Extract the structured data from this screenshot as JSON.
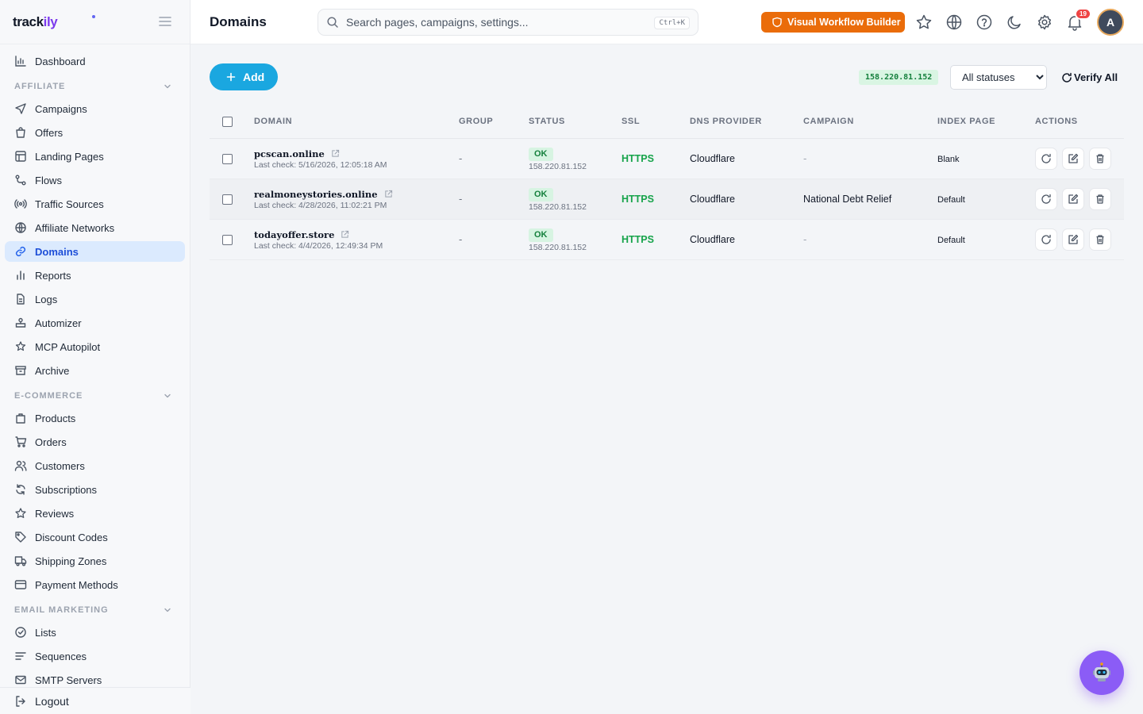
{
  "brand": {
    "prefix": "track",
    "suffix": "ily"
  },
  "sidebar": {
    "items_top": [
      {
        "label": "Dashboard",
        "icon": "dashboard-icon"
      }
    ],
    "sections": [
      {
        "title": "AFFILIATE",
        "items": [
          {
            "label": "Campaigns",
            "icon": "send-icon"
          },
          {
            "label": "Offers",
            "icon": "shopping-bag-icon"
          },
          {
            "label": "Landing Pages",
            "icon": "layout-icon"
          },
          {
            "label": "Flows",
            "icon": "route-icon"
          },
          {
            "label": "Traffic Sources",
            "icon": "radio-icon"
          },
          {
            "label": "Affiliate Networks",
            "icon": "globe-icon"
          },
          {
            "label": "Domains",
            "icon": "link-icon",
            "active": true
          },
          {
            "label": "Reports",
            "icon": "bar-chart-icon"
          },
          {
            "label": "Logs",
            "icon": "file-text-icon"
          },
          {
            "label": "Automizer",
            "icon": "automizer-icon"
          },
          {
            "label": "MCP Autopilot",
            "icon": "sparkle-star-icon"
          },
          {
            "label": "Archive",
            "icon": "archive-icon"
          }
        ]
      },
      {
        "title": "E-COMMERCE",
        "items": [
          {
            "label": "Products",
            "icon": "package-icon"
          },
          {
            "label": "Orders",
            "icon": "cart-icon"
          },
          {
            "label": "Customers",
            "icon": "users-icon"
          },
          {
            "label": "Subscriptions",
            "icon": "refresh-icon"
          },
          {
            "label": "Reviews",
            "icon": "star-icon"
          },
          {
            "label": "Discount Codes",
            "icon": "tag-icon"
          },
          {
            "label": "Shipping Zones",
            "icon": "truck-icon"
          },
          {
            "label": "Payment Methods",
            "icon": "credit-card-icon"
          }
        ]
      },
      {
        "title": "EMAIL MARKETING",
        "items": [
          {
            "label": "Lists",
            "icon": "check-circle-icon"
          },
          {
            "label": "Sequences",
            "icon": "lines-icon"
          },
          {
            "label": "SMTP Servers",
            "icon": "mail-icon"
          }
        ]
      }
    ],
    "logout_label": "Logout"
  },
  "header": {
    "title": "Domains",
    "search_placeholder": "Search pages, campaigns, settings...",
    "search_shortcut": "Ctrl+K",
    "workflow_button": "Visual Workflow Builder",
    "notification_count": "19",
    "avatar_initial": "A"
  },
  "toolbar": {
    "add_label": "Add",
    "server_ip": "158.220.81.152",
    "status_filter": {
      "selected": "All statuses",
      "options": [
        "All statuses"
      ]
    },
    "verify_all_label": "Verify All"
  },
  "table": {
    "columns": [
      "DOMAIN",
      "GROUP",
      "STATUS",
      "SSL",
      "DNS PROVIDER",
      "CAMPAIGN",
      "INDEX PAGE",
      "ACTIONS"
    ],
    "rows": [
      {
        "domain": "pcscan.online",
        "last_check": "Last check: 5/16/2026, 12:05:18 AM",
        "group": "-",
        "status": "OK",
        "status_ip": "158.220.81.152",
        "ssl": "HTTPS",
        "dns_provider": "Cloudflare",
        "campaign": "-",
        "index_page": "Blank"
      },
      {
        "domain": "realmoneystories.online",
        "last_check": "Last check: 4/28/2026, 11:02:21 PM",
        "group": "-",
        "status": "OK",
        "status_ip": "158.220.81.152",
        "ssl": "HTTPS",
        "dns_provider": "Cloudflare",
        "campaign": "National Debt Relief",
        "index_page": "Default"
      },
      {
        "domain": "todayoffer.store",
        "last_check": "Last check: 4/4/2026, 12:49:34 PM",
        "group": "-",
        "status": "OK",
        "status_ip": "158.220.81.152",
        "ssl": "HTTPS",
        "dns_provider": "Cloudflare",
        "campaign": "-",
        "index_page": "Default"
      }
    ]
  },
  "colors": {
    "accent": "#1aa7e0",
    "active_nav_bg": "#dbeafe",
    "workflow_button": "#ea6c0a",
    "ok_green": "#15803d",
    "https_green": "#16a34a",
    "badge_red": "#ef4444",
    "bot_purple": "#8b5cf6"
  }
}
